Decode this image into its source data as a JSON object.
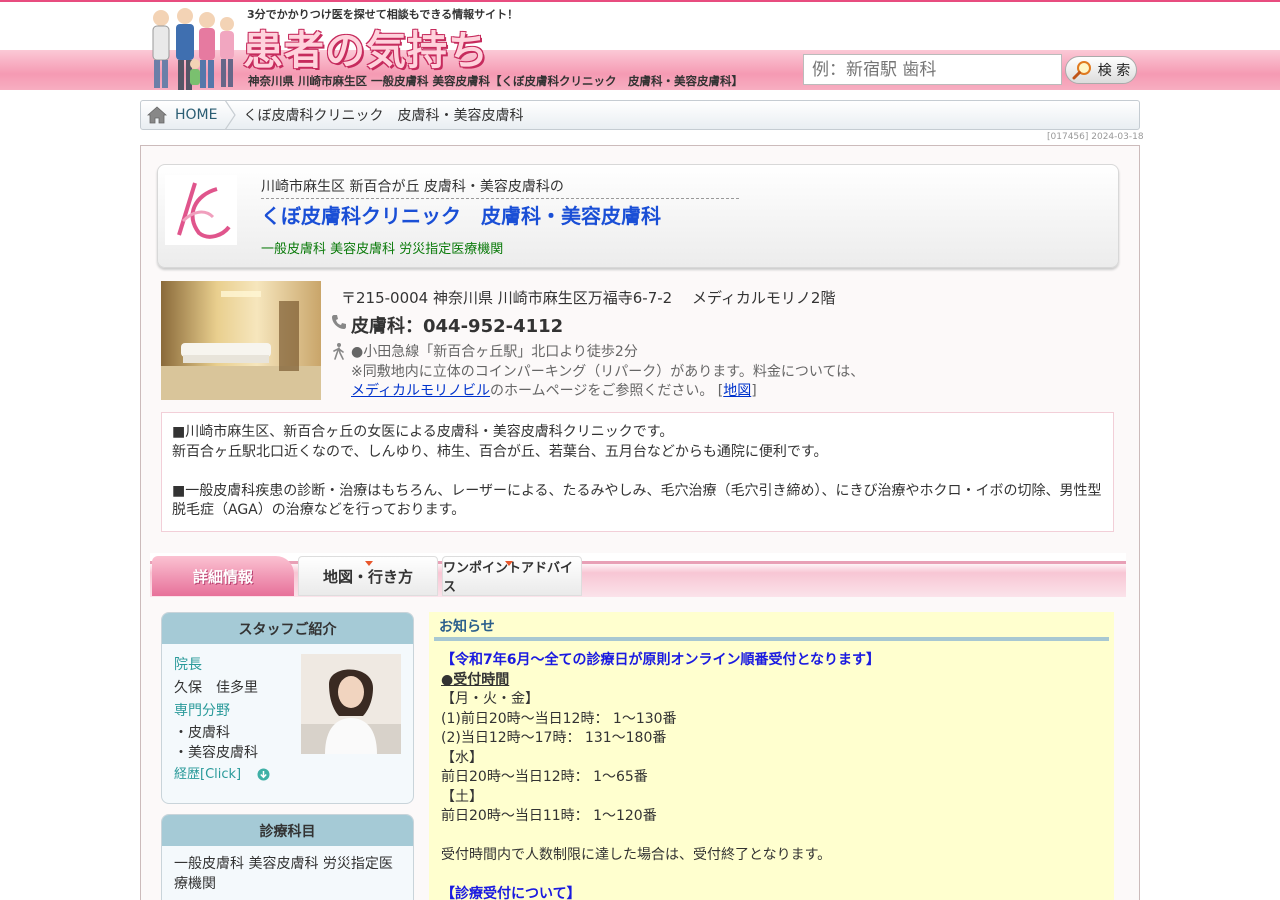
{
  "header": {
    "tagline": "3分でかかりつけ医を探せて相談もできる情報サイト！",
    "logo_text": "患者の気持ち",
    "breadcrumb_text": "神奈川県 川崎市麻生区 一般皮膚科 美容皮膚科【くぼ皮膚科クリニック　皮膚科・美容皮膚科】",
    "search_placeholder": "例：新宿駅 歯科",
    "search_button": "検 索"
  },
  "breadcrumb": {
    "home": "HOME",
    "current": "くぼ皮膚科クリニック　皮膚科・美容皮膚科",
    "stamp": "[017456] 2024-03-18"
  },
  "clinic": {
    "subtitle": "川崎市麻生区 新百合が丘 皮膚科・美容皮膚科の",
    "name": "くぼ皮膚科クリニック　皮膚科・美容皮膚科",
    "tags": "一般皮膚科 美容皮膚科 労災指定医療機関",
    "address": "〒215-0004 神奈川県 川崎市麻生区万福寺6-7-2　 メディカルモリノ2階",
    "phone": "皮膚科：044-952-4112",
    "access_line1": "●小田急線「新百合ヶ丘駅」北口より徒歩2分",
    "access_line2": "※同敷地内に立体のコインパーキング（リパーク）があります。料金については、",
    "access_link": "メディカルモリノビル",
    "access_line3": "のホームページをご参照ください。 [",
    "map_link": "地図",
    "access_end": "]"
  },
  "intro": {
    "p1": "■川崎市麻生区、新百合ヶ丘の女医による皮膚科・美容皮膚科クリニックです。",
    "p2": "新百合ヶ丘駅北口近くなので、しんゆり、柿生、百合が丘、若葉台、五月台などからも通院に便利です。",
    "p3": "■一般皮膚科疾患の診断・治療はもちろん、レーザーによる、たるみやしみ、毛穴治療（毛穴引き締め）、にきび治療やホクロ・イボの切除、男性型脱毛症（AGA）の治療などを行っております。"
  },
  "tabs": {
    "details": "詳細情報",
    "map": "地図・行き方",
    "advice": "ワンポイントアドバイス"
  },
  "staff": {
    "title": "スタッフご紹介",
    "role_label": "院長",
    "name": "久保　佳多里",
    "specialty_label": "専門分野",
    "specialty1": "・皮膚科",
    "specialty2": "・美容皮膚科",
    "career": "経歴[Click]"
  },
  "departments": {
    "title": "診療科目",
    "body": "一般皮膚科 美容皮膚科 労災指定医療機関"
  },
  "news": {
    "title": "お知らせ",
    "headline": "【令和7年6月〜全ての診療日が原則オンライン順番受付となります】",
    "reception_label": "●受付時間",
    "l1": "【月・火・金】",
    "l2": "(1)前日20時〜当日12時： 1〜130番",
    "l3": "(2)当日12時〜17時： 131〜180番",
    "l4": "【水】",
    "l5": "前日20時〜当日12時： 1〜65番",
    "l6": "【土】",
    "l7": "前日20時〜当日11時： 1〜120番",
    "l8": "受付時間内で人数制限に達した場合は、受付終了となります。",
    "l9": "【診療受付について】"
  },
  "colors": {
    "accent_pink": "#e84c7f",
    "link_blue": "#0033cc",
    "box_head": "#a5cad6",
    "news_bg": "#ffffcf"
  }
}
